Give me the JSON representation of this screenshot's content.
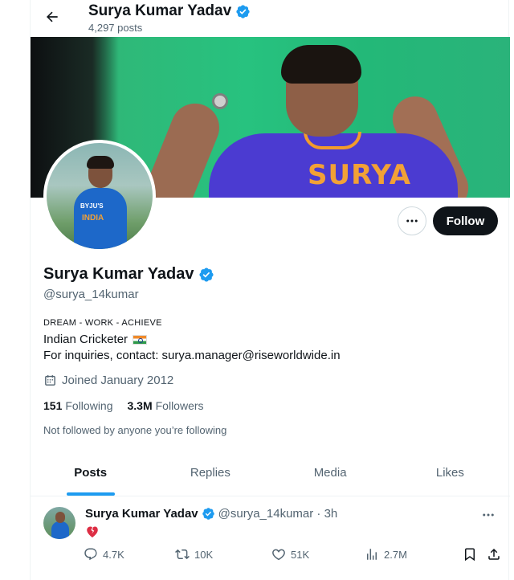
{
  "header": {
    "name": "Surya Kumar Yadav",
    "posts_count": "4,297 posts"
  },
  "profile": {
    "name": "Surya Kumar Yadav",
    "handle": "@surya_14kumar",
    "bio_line1": "DREAM - WORK - ACHIEVE",
    "bio_line2": "Indian Cricketer",
    "bio_line3": "For inquiries, contact: surya.manager@riseworldwide.in",
    "joined": "Joined January 2012",
    "following_count": "151",
    "following_label": "Following",
    "followers_count": "3.3M",
    "followers_label": "Followers",
    "not_followed": "Not followed by anyone you’re following",
    "verified_color": "#1d9bf0"
  },
  "banner": {
    "jersey_text": "SURYA"
  },
  "avatar": {
    "jersey_text1": "BYJU'S",
    "jersey_text2": "INDIA"
  },
  "buttons": {
    "follow_label": "Follow"
  },
  "tabs": [
    {
      "label": "Posts",
      "active": true
    },
    {
      "label": "Replies",
      "active": false
    },
    {
      "label": "Media",
      "active": false
    },
    {
      "label": "Likes",
      "active": false
    }
  ],
  "tweet": {
    "author": "Surya Kumar Yadav",
    "handle_time": "@surya_14kumar · 3h",
    "body_emoji": "broken-heart",
    "replies": "4.7K",
    "reposts": "10K",
    "likes": "51K",
    "views": "2.7M"
  },
  "icons": {
    "back": "arrow-left-icon",
    "verified": "verified-badge-icon",
    "more": "more-horizontal-icon",
    "calendar": "calendar-icon",
    "reply": "reply-icon",
    "repost": "repost-icon",
    "like": "heart-icon",
    "views": "views-icon",
    "bookmark": "bookmark-icon",
    "share": "share-icon"
  }
}
